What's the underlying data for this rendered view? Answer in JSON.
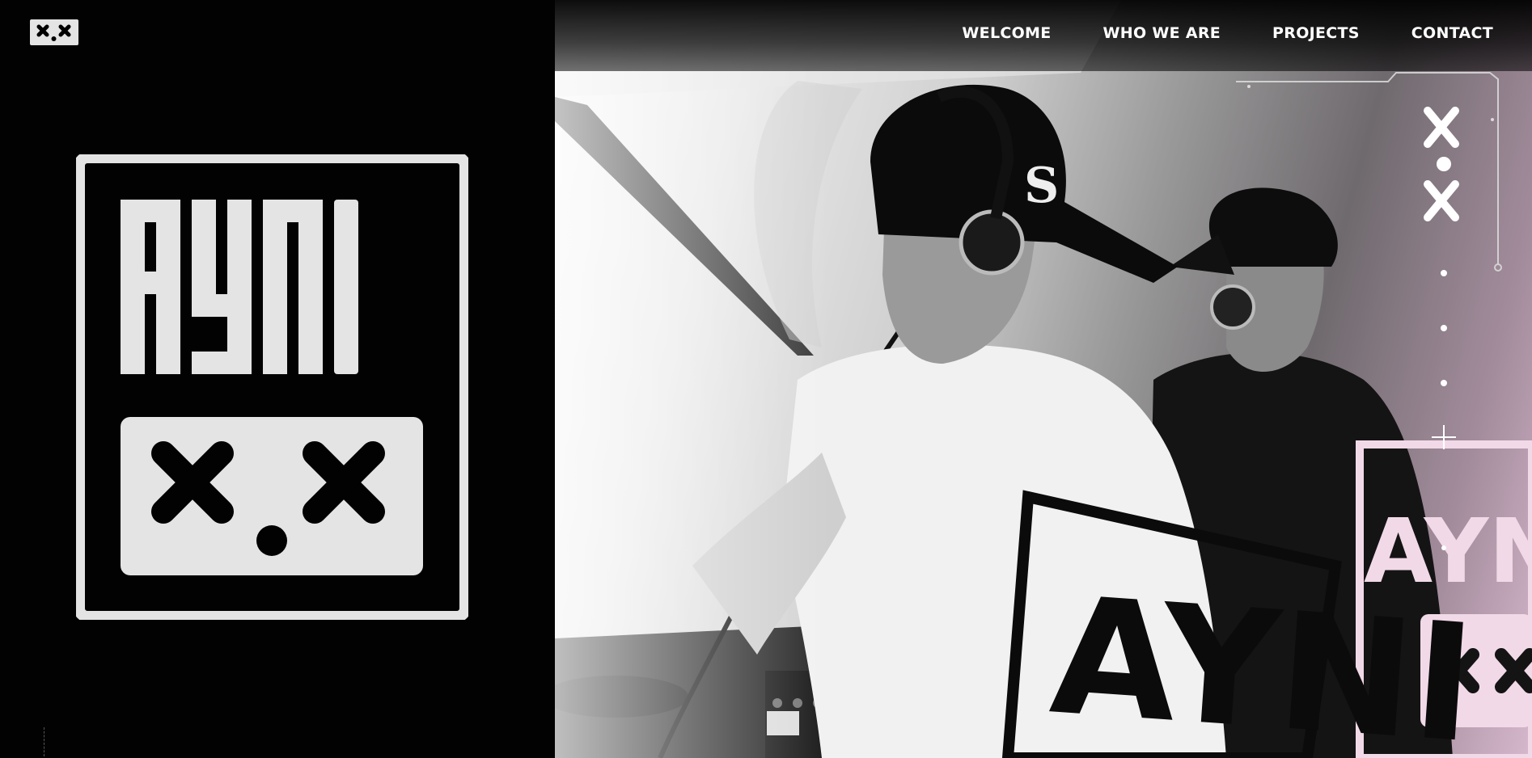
{
  "brand": {
    "name": "AYNI",
    "mark": "X.X"
  },
  "nav": {
    "items": [
      {
        "label": "WELCOME"
      },
      {
        "label": "WHO WE ARE"
      },
      {
        "label": "PROJECTS"
      },
      {
        "label": "CONTACT"
      }
    ]
  },
  "colors": {
    "background": "#000000",
    "logo": "#e4e4e4",
    "nav_text": "#ffffff",
    "accent_tint": "#d7b8cd"
  },
  "icons": {
    "hud_mark": "x-dot-x-icon",
    "hud_plus": "plus-icon",
    "hud_dots": "dot-icon"
  }
}
